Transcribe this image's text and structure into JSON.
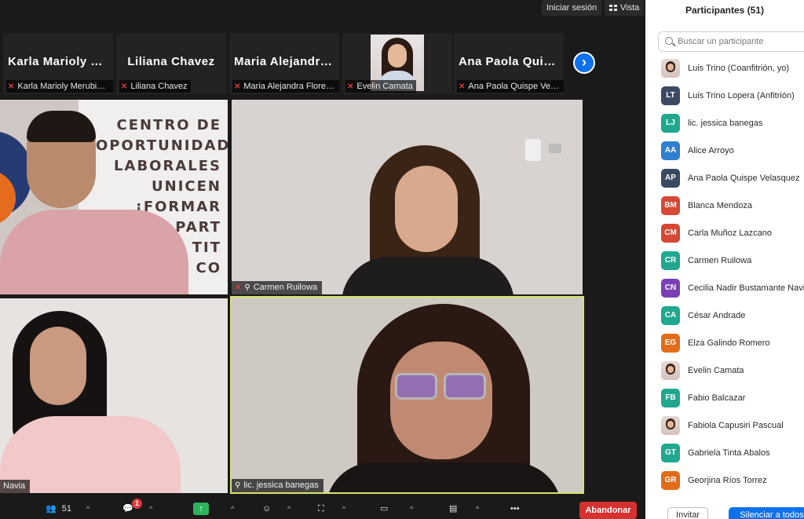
{
  "topbar": {
    "signin_label": "Iniciar sesión",
    "view_label": "Vista"
  },
  "thumbnails": [
    {
      "display_name": "Karla Marioly M...",
      "label": "Karla Marioly Merubia ..."
    },
    {
      "display_name": "Liliana Chavez",
      "label": "Liliana Chavez"
    },
    {
      "display_name": "Maria Alejandra...",
      "label": "Maria Alejandra Flores..."
    },
    {
      "display_name": "",
      "label": "Evelin Camata"
    },
    {
      "display_name": "Ana Paola Quis...",
      "label": "Ana Paola Quispe Vela..."
    }
  ],
  "videos": {
    "tile1": {
      "label": "",
      "banner_text": "CENTRO DE\nOPORTUNIDAD\nLABORALES\nUNICEN\n¡FORMAR\nPART\nTIT\nCO"
    },
    "tile2": {
      "label": "Carmen Ruilowa"
    },
    "tile3": {
      "label": "Navia"
    },
    "tile4": {
      "label": "lic. jessica banegas"
    }
  },
  "toolbar": {
    "participants_count": "51",
    "chat_badge": "1",
    "leave_label": "Abandonar"
  },
  "panel": {
    "title": "Participantes (51)",
    "search_placeholder": "Buscar un participante",
    "participants": [
      {
        "initials": "",
        "name": "Luis Trino (Coanfitrión, yo)",
        "color": "#7a9cc6",
        "photo": true
      },
      {
        "initials": "LT",
        "name": "Luis Trino Lopera (Anfitrión)",
        "color": "#3a4a63"
      },
      {
        "initials": "LJ",
        "name": "lic. jessica banegas",
        "color": "#1fa88d"
      },
      {
        "initials": "AA",
        "name": "Alice Arroyo",
        "color": "#2f7fd1"
      },
      {
        "initials": "AP",
        "name": "Ana Paola Quispe Velasquez",
        "color": "#3a4a63"
      },
      {
        "initials": "BM",
        "name": "Blanca Mendoza",
        "color": "#d64734"
      },
      {
        "initials": "CM",
        "name": "Carla Muñoz Lazcano",
        "color": "#d64734"
      },
      {
        "initials": "CR",
        "name": "Carmen Ruilowa",
        "color": "#1fa88d"
      },
      {
        "initials": "CN",
        "name": "Cecilia Nadir Bustamante Navia",
        "color": "#7b3fb5"
      },
      {
        "initials": "CA",
        "name": "César Andrade",
        "color": "#1fa88d"
      },
      {
        "initials": "EG",
        "name": "Elza Galindo Romero",
        "color": "#e36c18"
      },
      {
        "initials": "",
        "name": "Evelin Camata",
        "color": "#cccccc",
        "photo": true
      },
      {
        "initials": "FB",
        "name": "Fabio Balcazar",
        "color": "#1fa88d"
      },
      {
        "initials": "",
        "name": "Fabiola Capusiri  Pascual",
        "color": "#cccccc",
        "photo": true
      },
      {
        "initials": "GT",
        "name": "Gabriela Tinta Abalos",
        "color": "#1fa88d"
      },
      {
        "initials": "GR",
        "name": "Georjina Ríos Torrez",
        "color": "#e36c18"
      }
    ],
    "invite_label": "Invitar",
    "mute_all_label": "Silenciar a todos"
  }
}
